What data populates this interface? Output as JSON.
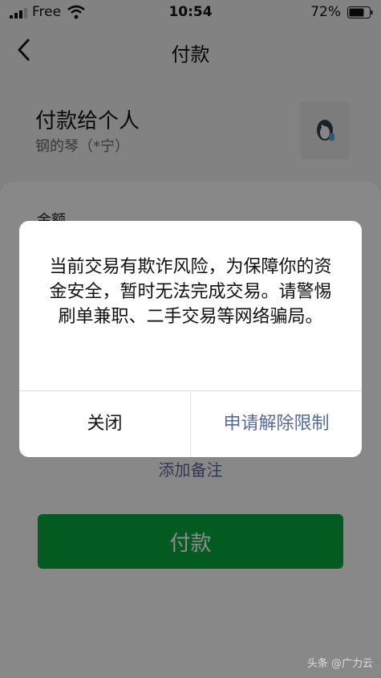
{
  "status_bar": {
    "carrier": "Free",
    "time": "10:54",
    "battery": "72%"
  },
  "nav": {
    "title": "付款",
    "back_icon": "chevron-left-icon"
  },
  "payee": {
    "title": "付款给个人",
    "name": "钢的琴（*宁）"
  },
  "form": {
    "amount_label": "金额",
    "add_remark": "添加备注",
    "pay_button": "付款"
  },
  "dialog": {
    "message": "当前交易有欺诈风险，为保障你的资金安全，暂时无法完成交易。请警惕刷单兼职、二手交易等网络骗局。",
    "close_button": "关闭",
    "appeal_button": "申请解除限制"
  },
  "watermark": "头条 @广力云",
  "colors": {
    "link_blue": "#576b95",
    "pay_green": "#07a63e"
  }
}
